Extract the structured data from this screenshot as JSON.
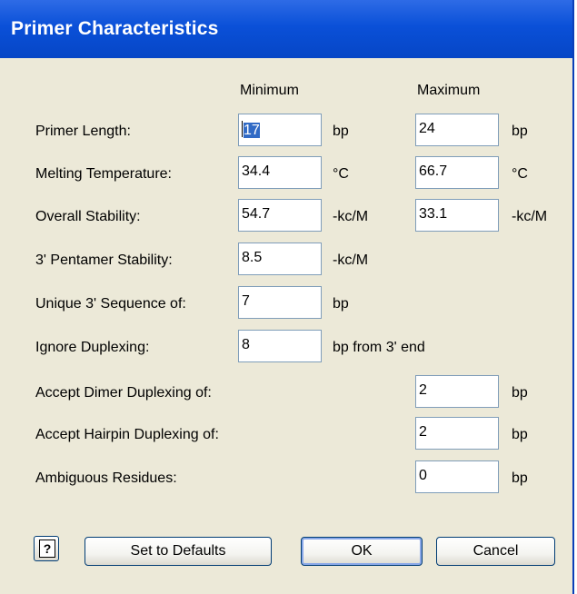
{
  "window": {
    "title": "Primer Characteristics"
  },
  "headers": {
    "minimum": "Minimum",
    "maximum": "Maximum"
  },
  "rows": {
    "primer_length": {
      "label": "Primer Length:",
      "min": "17",
      "min_unit": "bp",
      "max": "24",
      "max_unit": "bp"
    },
    "melting_temperature": {
      "label": "Melting Temperature:",
      "min": "34.4",
      "min_unit": "°C",
      "max": "66.7",
      "max_unit": "°C"
    },
    "overall_stability": {
      "label": "Overall Stability:",
      "min": "54.7",
      "min_unit": "-kc/M",
      "max": "33.1",
      "max_unit": "-kc/M"
    },
    "pentamer_stability": {
      "label": "3' Pentamer Stability:",
      "min": "8.5",
      "min_unit": "-kc/M"
    },
    "unique_sequence": {
      "label": "Unique 3' Sequence of:",
      "min": "7",
      "min_unit": "bp"
    },
    "ignore_duplexing": {
      "label": "Ignore Duplexing:",
      "min": "8",
      "min_unit": "bp from 3' end"
    },
    "dimer_duplexing": {
      "label": "Accept Dimer Duplexing of:",
      "max": "2",
      "max_unit": "bp"
    },
    "hairpin_duplexing": {
      "label": "Accept Hairpin Duplexing of:",
      "max": "2",
      "max_unit": "bp"
    },
    "ambiguous_residues": {
      "label": "Ambiguous Residues:",
      "max": "0",
      "max_unit": "bp"
    }
  },
  "buttons": {
    "help": "?",
    "defaults": "Set to Defaults",
    "ok": "OK",
    "cancel": "Cancel"
  },
  "colors": {
    "titlebar": "#0a50d8",
    "dialog_bg": "#ece9d8",
    "selection": "#316ac5",
    "field_border": "#7f9db9"
  },
  "icons": {
    "help": "help-icon"
  }
}
